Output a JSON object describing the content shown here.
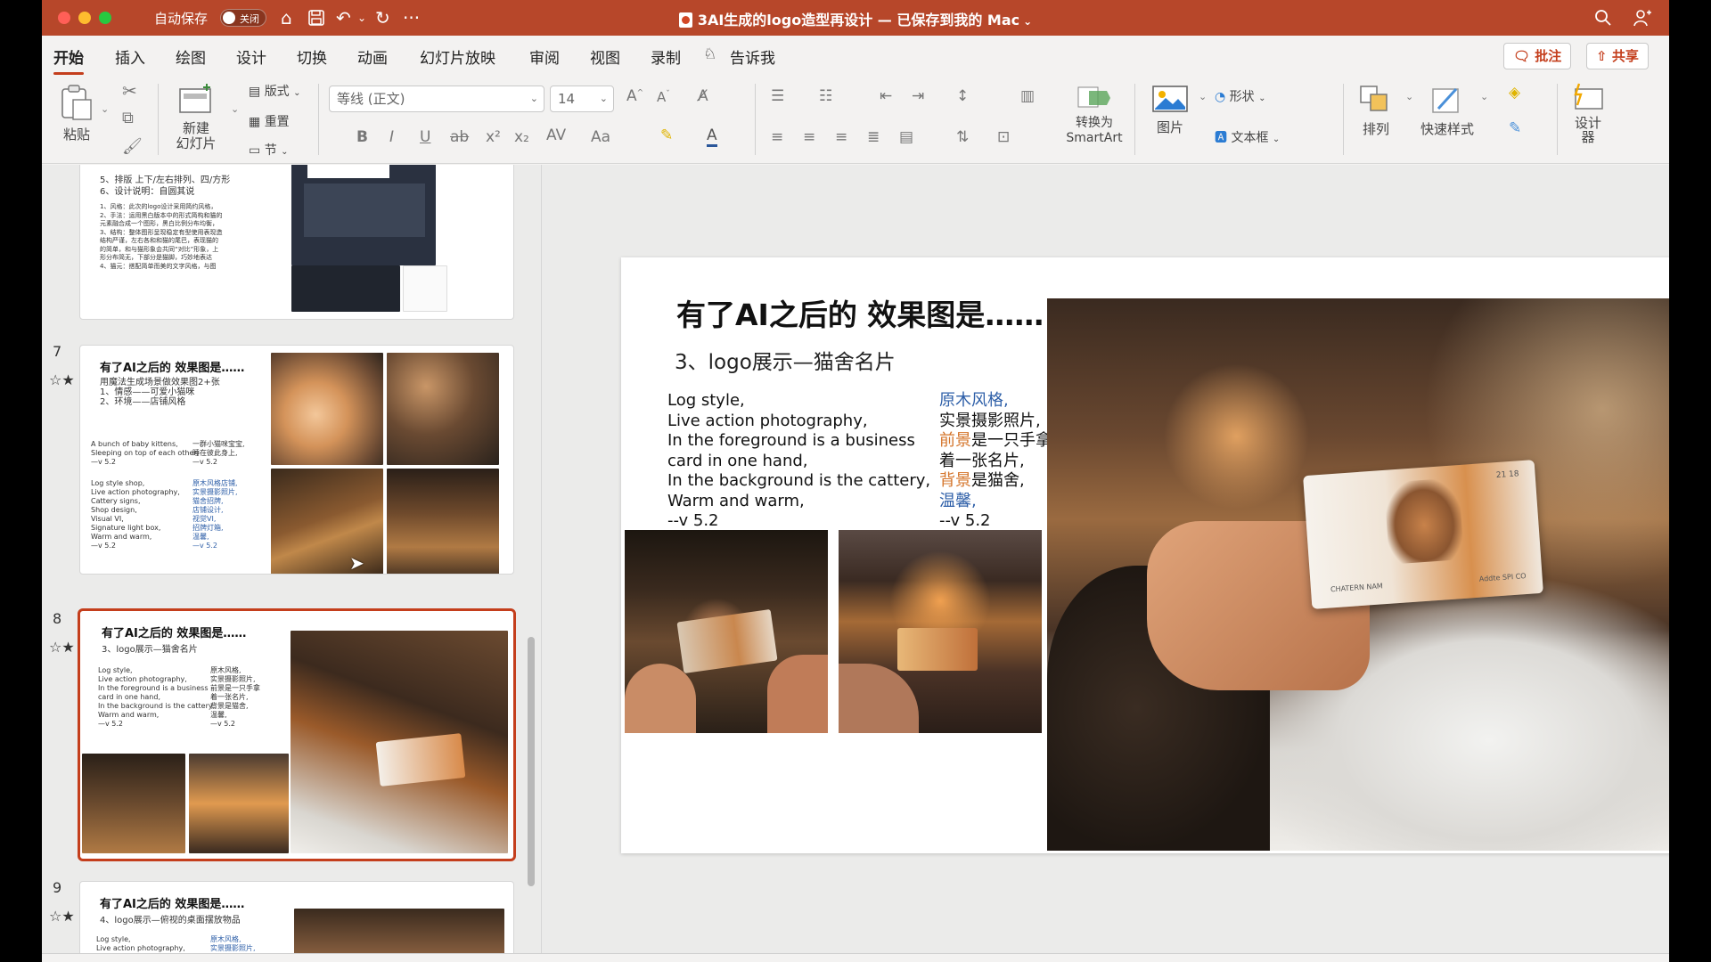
{
  "titlebar": {
    "autosave_label": "自动保存",
    "autosave_state": "关闭",
    "doc_title": "3AI生成的logo造型再设计 — 已保存到我的 Mac",
    "icons": [
      "home-icon",
      "save-icon",
      "undo-icon",
      "redo-icon",
      "more-icon",
      "search-icon",
      "share-people-icon"
    ]
  },
  "tabs": [
    "开始",
    "插入",
    "绘图",
    "设计",
    "切换",
    "动画",
    "幻灯片放映",
    "审阅",
    "视图",
    "录制",
    "告诉我"
  ],
  "header_buttons": {
    "comments": "批注",
    "share": "共享"
  },
  "ribbon": {
    "paste": "粘贴",
    "new_slide_1": "新建",
    "new_slide_2": "幻灯片",
    "layout": "版式",
    "reset": "重置",
    "section": "节",
    "font_name": "等线 (正文)",
    "font_size": "14",
    "smartart_1": "转换为",
    "smartart_2": "SmartArt",
    "picture": "图片",
    "shapes": "形状",
    "textbox": "文本框",
    "arrange": "排列",
    "quick_styles": "快速样式",
    "designer_1": "设计",
    "designer_2": "器"
  },
  "thumbnails": {
    "slide6": {
      "lines": "5、排版 上下/左右排列、四/方形\n6、设计说明：自圆其说",
      "body": "1、风格：此次的logo设计采用简约风格，\n2、手法：运用黑白版本中的形式简构和猫的\n元素融合成一个图形，黑白比例分布均衡，\n3、结构：整体图形呈现稳定有型使用表现造\n结构严谨，左右各和和猫的尾巴，表现猫的\n的简单，和与猫形象会共同“对比”形象，上\n形分布简无，下部分是猫脚，巧妙地表达\n4、猫元：搭配简单而美的文字风格，与图"
    },
    "slide7": {
      "num": "7",
      "title": "有了AI之后的 效果图是……",
      "lines": "用魔法生成场景做效果图2+张\n1、情感——可爱小猫咪\n2、环境——店铺风格",
      "en1": "A bunch of baby kittens,\nSleeping on top of each other,\n—v 5.2",
      "zh1": "一群小猫咪宝宝,\n睡在彼此身上,\n—v 5.2",
      "en2": "Log style shop,\nLive action photography,\nCattery signs,\nShop design,\nVisual VI,\nSignature light box,\nWarm and warm,\n—v 5.2",
      "zh2": "原木风格店铺,\n实景摄影照片,\n猫舍招牌,\n店铺设计,\n视觉VI,\n招牌灯箱,\n温馨,\n—v 5.2"
    },
    "slide8": {
      "num": "8",
      "title": "有了AI之后的 效果图是……",
      "sub": "3、logo展示—猫舍名片",
      "en": "Log style,\nLive action photography,\nIn the foreground is a business\ncard in one hand,\nIn the background is the cattery,\nWarm and warm,\n—v 5.2",
      "zh": "原木风格,\n实景摄影照片,\n前景是一只手拿\n着一张名片,\n背景是猫舍,\n温馨,\n—v 5.2"
    },
    "slide9": {
      "num": "9",
      "title": "有了AI之后的 效果图是……",
      "sub": "4、logo展示—俯视的桌面摆放物品",
      "en": "Log style,\nLive action photography,",
      "zh": "原木风格,\n实景摄影照片,"
    }
  },
  "slide": {
    "title": "有了AI之后的 效果图是……",
    "subtitle": "3、logo展示—猫舍名片",
    "english_prompt": [
      "Log style,",
      "Live action photography,",
      "In the foreground is a business",
      "card in one hand,",
      "In the background is the cattery,",
      "Warm and warm,",
      "--v 5.2"
    ],
    "chinese_prompt": {
      "l1": "原木风格,",
      "l2": "实景摄影照片,",
      "l3a": "前景",
      "l3b": "是一只手拿",
      "l4": "着一张名片,",
      "l5a": "背景",
      "l5b": "是猫舍,",
      "l6": "温馨,",
      "l7": "--v 5.2"
    },
    "card_texts": {
      "number": "21 18",
      "left": "CHATERN NAM",
      "right": "Addte SPI CO"
    }
  },
  "colors": {
    "accent": "#c43e1c",
    "titlebar": "#b7472a",
    "zh_blue": "#2e5fa8",
    "zh_orange": "#d4742a"
  }
}
